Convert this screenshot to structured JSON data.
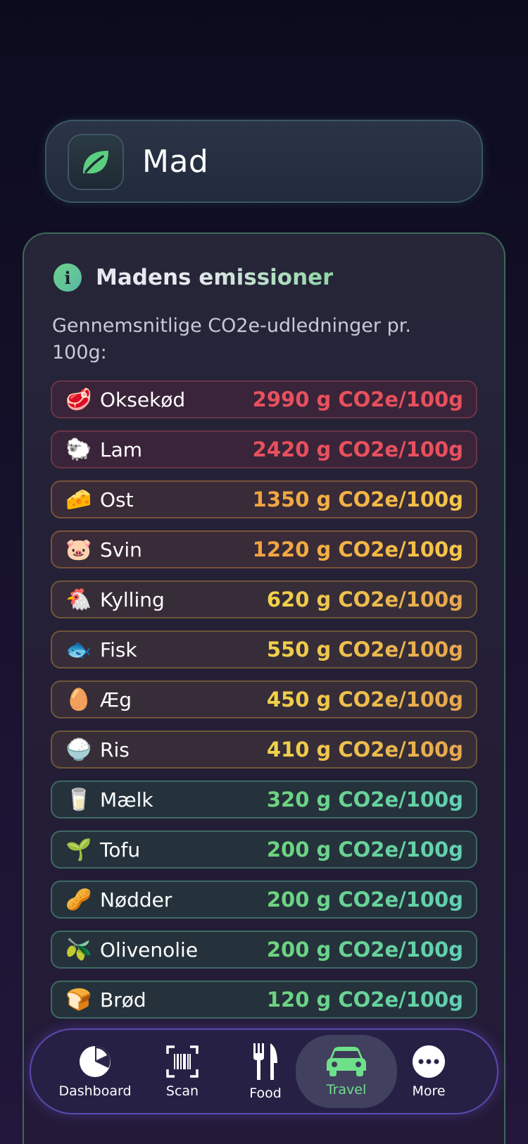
{
  "header": {
    "title": "Mad",
    "icon": "leaf-icon",
    "icon_color": "#5ccf80"
  },
  "card": {
    "title": "Madens emissioner",
    "subtitle": "Gennemsnitlige CO2e-udledninger pr. 100g:",
    "rows": [
      {
        "emoji": "🥩",
        "name": "Oksekød",
        "value": "2990 g CO2e/100g",
        "level": "high"
      },
      {
        "emoji": "🐑",
        "name": "Lam",
        "value": "2420 g CO2e/100g",
        "level": "high"
      },
      {
        "emoji": "🧀",
        "name": "Ost",
        "value": "1350 g CO2e/100g",
        "level": "medh"
      },
      {
        "emoji": "🐷",
        "name": "Svin",
        "value": "1220 g CO2e/100g",
        "level": "medh"
      },
      {
        "emoji": "🐔",
        "name": "Kylling",
        "value": "620 g CO2e/100g",
        "level": "med"
      },
      {
        "emoji": "🐟",
        "name": "Fisk",
        "value": "550 g CO2e/100g",
        "level": "med"
      },
      {
        "emoji": "🥚",
        "name": "Æg",
        "value": "450 g CO2e/100g",
        "level": "med"
      },
      {
        "emoji": "🍚",
        "name": "Ris",
        "value": "410 g CO2e/100g",
        "level": "med"
      },
      {
        "emoji": "🥛",
        "name": "Mælk",
        "value": "320 g CO2e/100g",
        "level": "low"
      },
      {
        "emoji": "🌱",
        "name": "Tofu",
        "value": "200 g CO2e/100g",
        "level": "low"
      },
      {
        "emoji": "🥜",
        "name": "Nødder",
        "value": "200 g CO2e/100g",
        "level": "low"
      },
      {
        "emoji": "🫒",
        "name": "Olivenolie",
        "value": "200 g CO2e/100g",
        "level": "low"
      },
      {
        "emoji": "🍞",
        "name": "Brød",
        "value": "120 g CO2e/100g",
        "level": "low"
      }
    ]
  },
  "tabbar": {
    "tabs": [
      {
        "label": "Dashboard",
        "icon": "pie-chart-icon"
      },
      {
        "label": "Scan",
        "icon": "barcode-scan-icon"
      },
      {
        "label": "Food",
        "icon": "fork-knife-icon"
      },
      {
        "label": "Travel",
        "icon": "car-icon",
        "active": true
      },
      {
        "label": "More",
        "icon": "more-icon"
      }
    ],
    "active_color": "#6fe08a"
  }
}
